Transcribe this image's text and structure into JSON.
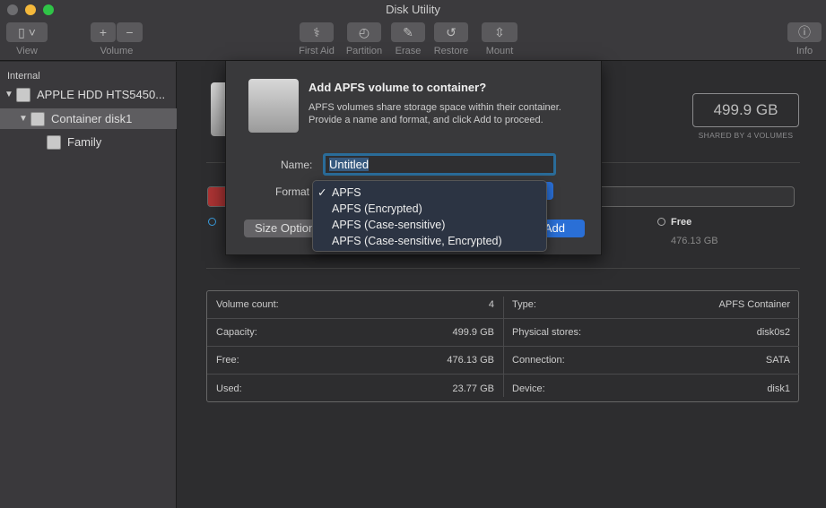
{
  "window": {
    "title": "Disk Utility"
  },
  "toolbar": {
    "view": "View",
    "volume": "Volume",
    "first_aid": "First Aid",
    "partition": "Partition",
    "erase": "Erase",
    "restore": "Restore",
    "mount": "Mount",
    "info": "Info",
    "plus": "+",
    "minus": "−"
  },
  "sidebar": {
    "section": "Internal",
    "items": [
      {
        "label": "APPLE HDD HTS5450..."
      },
      {
        "label": "Container disk1"
      },
      {
        "label": "Family"
      }
    ]
  },
  "dialog": {
    "title": "Add APFS volume to container?",
    "message": "APFS volumes share storage space within their container. Provide a name and format, and click Add to proceed.",
    "name_label": "Name:",
    "name_value": "Untitled",
    "format_label": "Format",
    "size_options": "Size Options...",
    "add": "Add"
  },
  "format_menu": {
    "selected": "APFS",
    "check": "✓",
    "options": [
      "APFS",
      "APFS (Encrypted)",
      "APFS (Case-sensitive)",
      "APFS (Case-sensitive, Encrypted)"
    ]
  },
  "capacity": {
    "value": "499.9 GB",
    "subtitle": "SHARED BY 4 VOLUMES"
  },
  "legend": {
    "free_label": "Free",
    "free_value": "476.13 GB"
  },
  "info": {
    "left": [
      {
        "k": "Volume count:",
        "v": "4"
      },
      {
        "k": "Capacity:",
        "v": "499.9 GB"
      },
      {
        "k": "Free:",
        "v": "476.13 GB"
      },
      {
        "k": "Used:",
        "v": "23.77 GB"
      }
    ],
    "right": [
      {
        "k": "Type:",
        "v": "APFS Container"
      },
      {
        "k": "Physical stores:",
        "v": "disk0s2"
      },
      {
        "k": "Connection:",
        "v": "SATA"
      },
      {
        "k": "Device:",
        "v": "disk1"
      }
    ]
  },
  "colors": {
    "accent": "#2a6fd6",
    "used": "#aa3333"
  }
}
